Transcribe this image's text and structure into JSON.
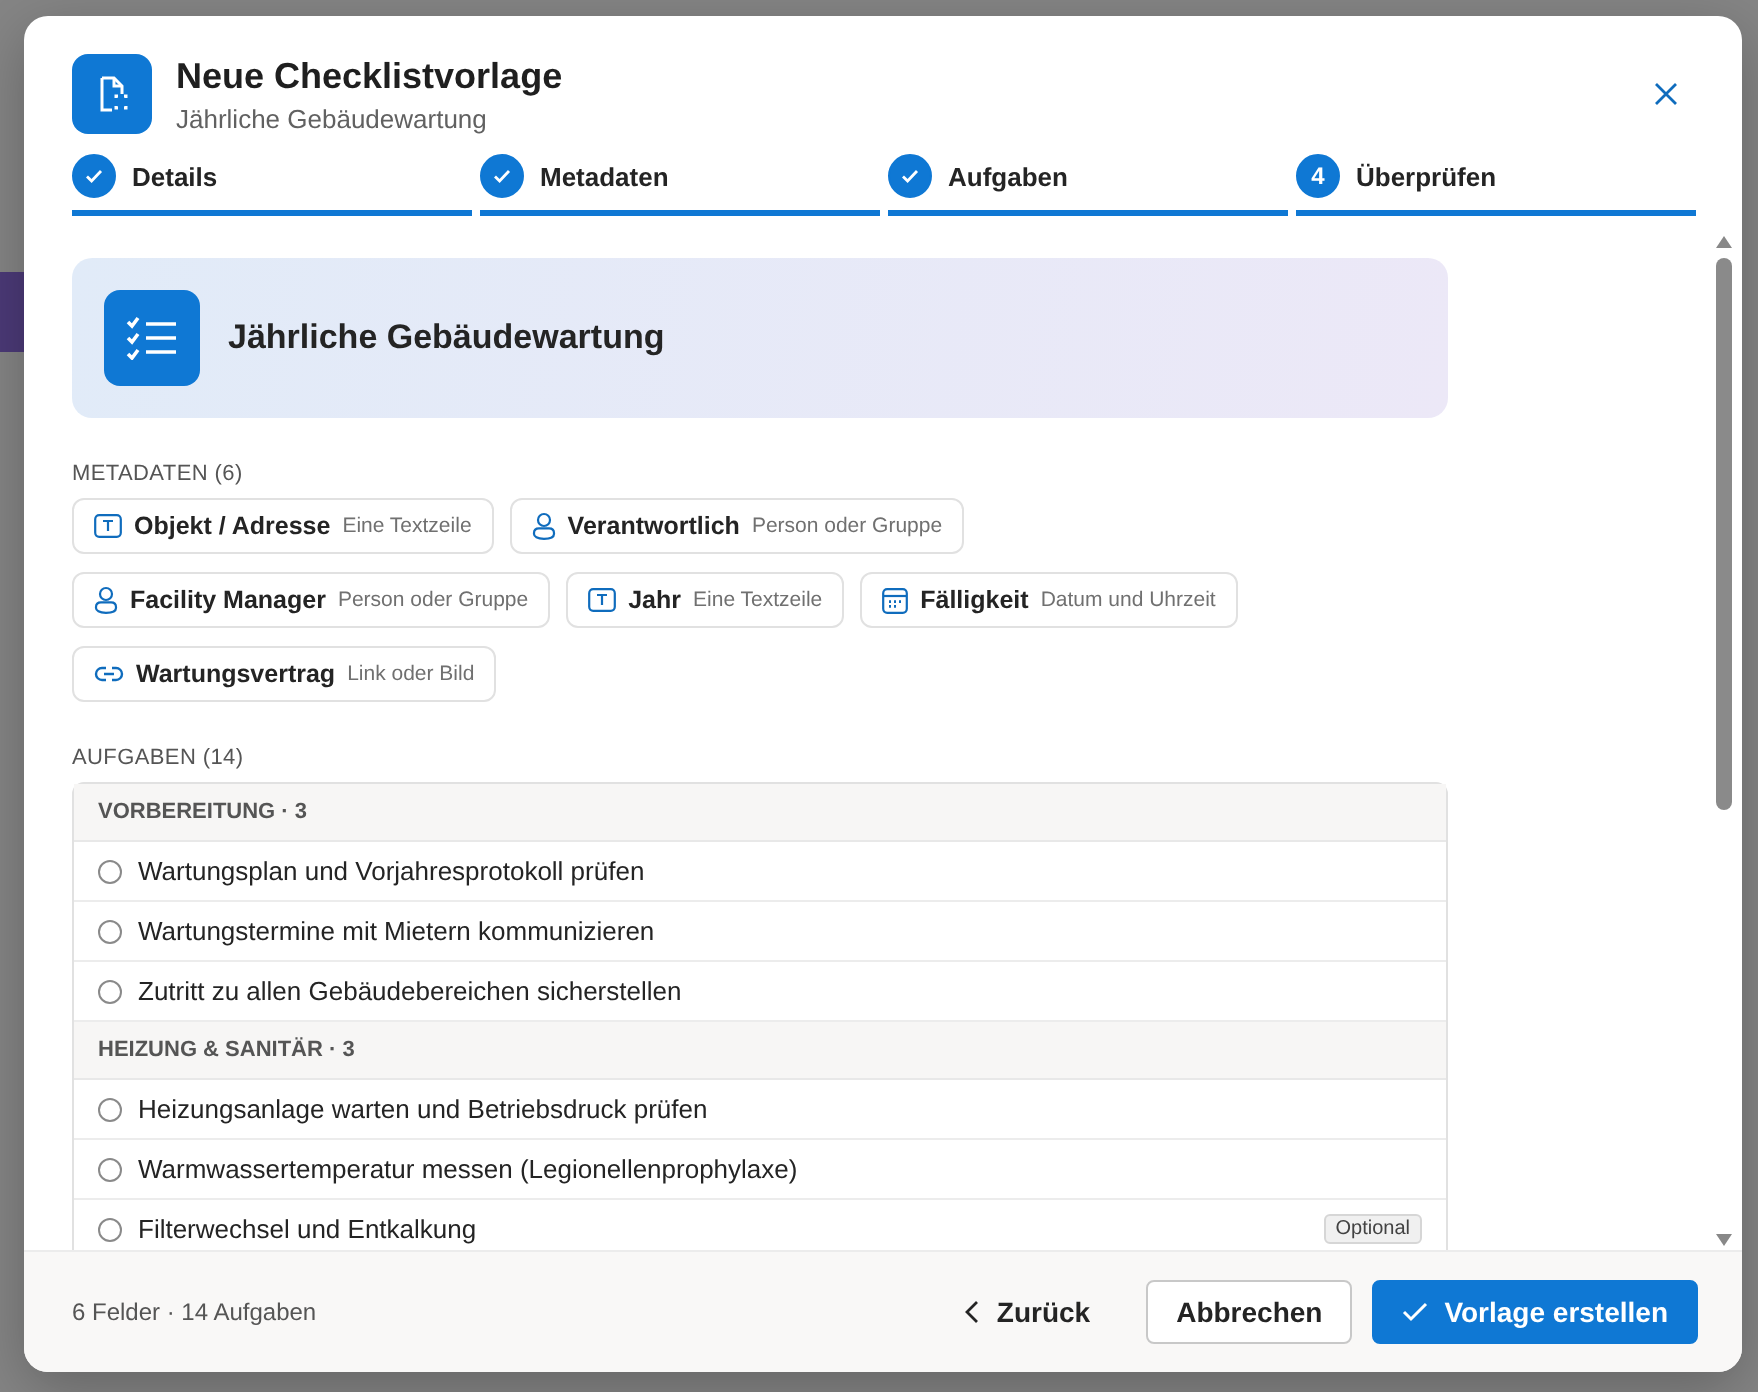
{
  "dialog": {
    "title": "Neue Checklistvorlage",
    "subtitle": "Jährliche Gebäudewartung"
  },
  "steps": [
    {
      "label": "Details",
      "done": true
    },
    {
      "label": "Metadaten",
      "done": true
    },
    {
      "label": "Aufgaben",
      "done": true
    },
    {
      "label": "Überprüfen",
      "done": false,
      "number": "4"
    }
  ],
  "summary": {
    "title": "Jährliche Gebäudewartung"
  },
  "metadata": {
    "heading": "METADATEN (6)",
    "fields": [
      {
        "kind": "text",
        "name": "Objekt / Adresse",
        "type": "Eine Textzeile"
      },
      {
        "kind": "person",
        "name": "Verantwortlich",
        "type": "Person oder Gruppe"
      },
      {
        "kind": "person",
        "name": "Facility Manager",
        "type": "Person oder Gruppe"
      },
      {
        "kind": "text",
        "name": "Jahr",
        "type": "Eine Textzeile"
      },
      {
        "kind": "date",
        "name": "Fälligkeit",
        "type": "Datum und Uhrzeit"
      },
      {
        "kind": "link",
        "name": "Wartungsvertrag",
        "type": "Link oder Bild"
      }
    ]
  },
  "tasks": {
    "heading": "AUFGABEN (14)",
    "groups": [
      {
        "title": "VORBEREITUNG · 3",
        "items": [
          {
            "label": "Wartungsplan und Vorjahresprotokoll prüfen",
            "checked": false
          },
          {
            "label": "Wartungstermine mit Mietern kommunizieren",
            "checked": false
          },
          {
            "label": "Zutritt zu allen Gebäudebereichen sicherstellen",
            "checked": false
          }
        ]
      },
      {
        "title": "HEIZUNG & SANITÄR · 3",
        "items": [
          {
            "label": "Heizungsanlage warten und Betriebsdruck prüfen",
            "checked": false
          },
          {
            "label": "Warmwassertemperatur messen (Legionellenprophylaxe)",
            "checked": false
          },
          {
            "label": "Filterwechsel und Entkalkung",
            "checked": false,
            "badge": "Optional"
          }
        ]
      }
    ]
  },
  "footer": {
    "info": "6 Felder · 14 Aufgaben",
    "back": "Zurück",
    "cancel": "Abbrechen",
    "submit": "Vorlage erstellen"
  }
}
